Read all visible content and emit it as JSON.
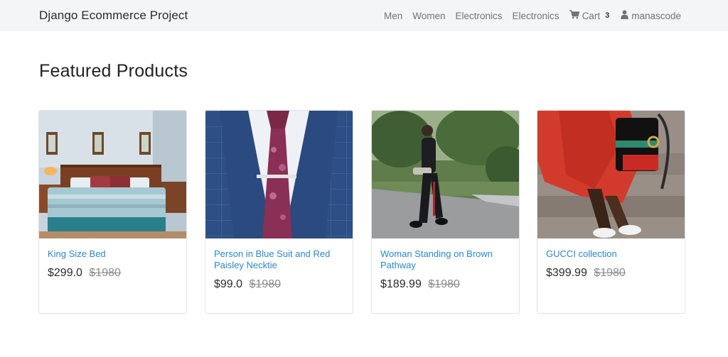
{
  "navbar": {
    "brand": "Django Ecommerce Project",
    "links": [
      {
        "label": "Men"
      },
      {
        "label": "Women"
      },
      {
        "label": "Electronics"
      },
      {
        "label": "Electronics"
      }
    ],
    "cart": {
      "label": "Cart",
      "count": "3",
      "icon": "cart-icon"
    },
    "user": {
      "label": "manascode",
      "icon": "user-icon"
    }
  },
  "main": {
    "heading": "Featured Products",
    "products": [
      {
        "title": "King Size Bed",
        "price": "$299.0",
        "old_price": "$1980",
        "image": "bedroom-photo"
      },
      {
        "title": "Person in Blue Suit and Red Paisley Necktie",
        "price": "$99.0",
        "old_price": "$1980",
        "image": "suit-tie-photo"
      },
      {
        "title": "Woman Standing on Brown Pathway",
        "price": "$189.99",
        "old_price": "$1980",
        "image": "woman-walking-photo"
      },
      {
        "title": "GUCCI collection",
        "price": "$399.99",
        "old_price": "$1980",
        "image": "gucci-bag-photo"
      }
    ]
  },
  "colors": {
    "navbar_bg": "#f4f5f7",
    "link": "#2a87c8",
    "text_muted": "#6f7378"
  }
}
